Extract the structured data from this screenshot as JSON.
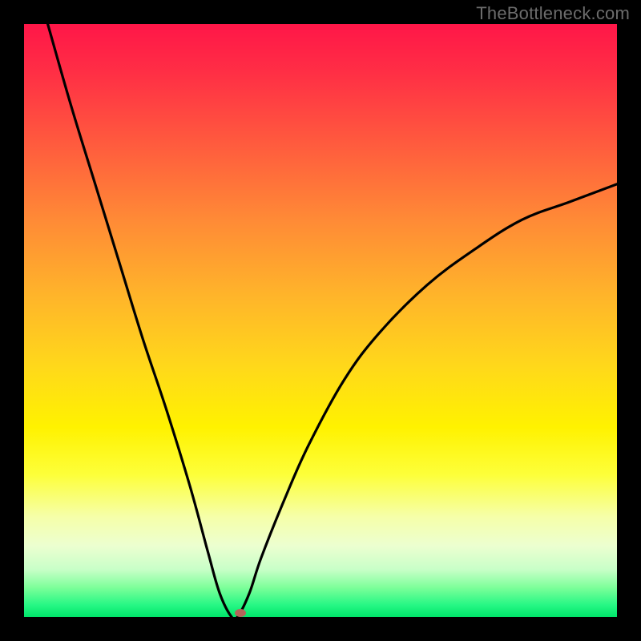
{
  "watermark": "TheBottleneck.com",
  "chart_data": {
    "type": "line",
    "title": "",
    "xlabel": "",
    "ylabel": "",
    "xlim": [
      0,
      100
    ],
    "ylim": [
      0,
      100
    ],
    "grid": false,
    "legend": false,
    "series": [
      {
        "name": "curve",
        "color": "#000000",
        "x": [
          4,
          8,
          12,
          16,
          20,
          24,
          28,
          31,
          33,
          35,
          36,
          38,
          40,
          44,
          48,
          54,
          60,
          68,
          76,
          84,
          92,
          100
        ],
        "values": [
          100,
          86,
          73,
          60,
          47,
          35,
          22,
          11,
          4,
          0,
          0,
          4,
          10,
          20,
          29,
          40,
          48,
          56,
          62,
          67,
          70,
          73
        ]
      }
    ],
    "marker": {
      "x": 36.5,
      "y": 0.7,
      "color": "#b4645a"
    },
    "background_gradient": {
      "direction": "top-to-bottom",
      "stops": [
        {
          "pos": 0.0,
          "color": "#ff1648"
        },
        {
          "pos": 0.33,
          "color": "#ff8a36"
        },
        {
          "pos": 0.68,
          "color": "#fff200"
        },
        {
          "pos": 1.0,
          "color": "#00e56a"
        }
      ]
    }
  }
}
